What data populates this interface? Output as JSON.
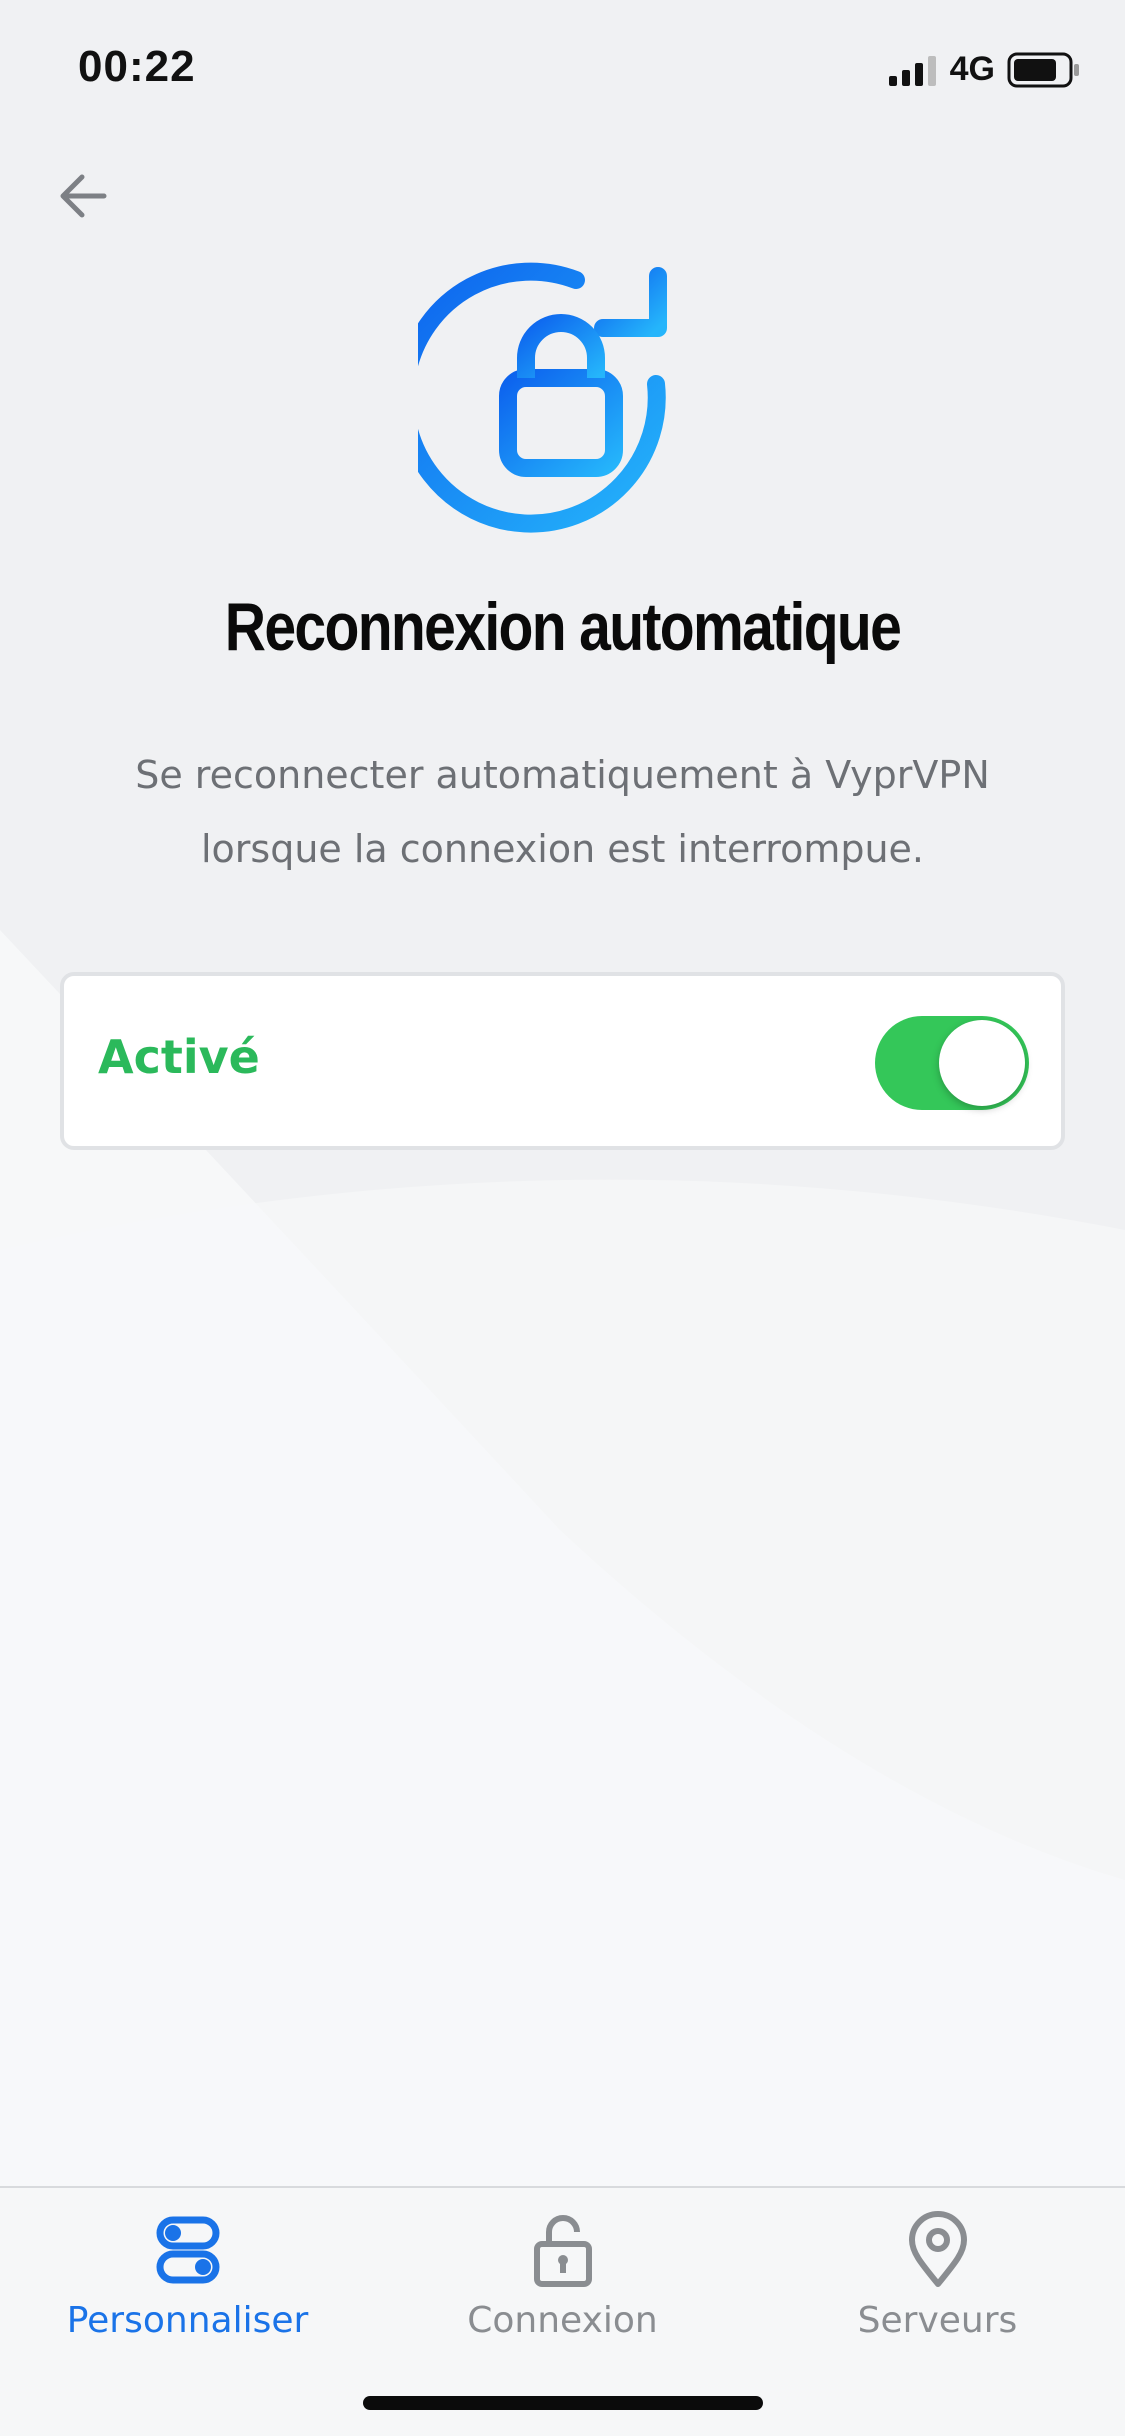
{
  "status_bar": {
    "time": "00:22",
    "network": "4G",
    "battery_level": 0.8
  },
  "header": {
    "back_icon": "arrow-left-icon",
    "hero_icon": "lock-refresh-icon",
    "title": "Reconnexion automatique",
    "description": "Se reconnecter automatiquement à VyprVPN lorsque la connexion est interrompue."
  },
  "setting": {
    "label": "Activé",
    "enabled": true,
    "label_color": "#2bb95b",
    "toggle_color": "#34c759"
  },
  "tabbar": {
    "tabs": [
      {
        "label": "Personnaliser",
        "icon": "toggles-icon",
        "active": true
      },
      {
        "label": "Connexion",
        "icon": "lock-icon",
        "active": false
      },
      {
        "label": "Serveurs",
        "icon": "location-pin-icon",
        "active": false
      }
    ],
    "active_color": "#1a73e8",
    "inactive_color": "#8a8d91"
  }
}
